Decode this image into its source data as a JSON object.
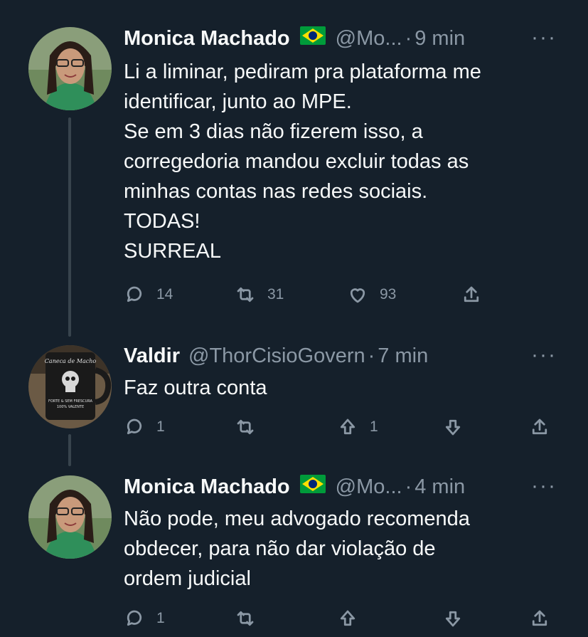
{
  "tweets": [
    {
      "name": "Monica Machado",
      "handle": "@Mo...",
      "time": "9 min",
      "text": "Li a liminar, pediram pra  plataforma me\nidentificar, junto ao MPE.\nSe em 3 dias não fizerem isso, a\ncorregedoria mandou excluir todas as\nminhas contas nas redes sociais.\nTODAS!\nSURREAL",
      "replies": "14",
      "retweets": "31",
      "likes": "93"
    },
    {
      "name": "Valdir",
      "handle": "@ThorCisioGovern",
      "time": "7 min",
      "text": "Faz outra conta",
      "replies": "1",
      "upvotes": "1",
      "avatar_mug_text": "Caneca de Macho",
      "avatar_mug_text2": "FORTE & SEM FRESCURA",
      "avatar_mug_text3": "100% VALENTE"
    },
    {
      "name": "Monica Machado",
      "handle": "@Mo...",
      "time": "4 min",
      "text": "Não pode, meu advogado recomenda\nobdecer, para não dar violação de\nordem judicial",
      "replies": "1"
    }
  ],
  "separator": "·",
  "more_glyph": "···",
  "colors": {
    "background": "#15202b",
    "text": "#f7f9f9",
    "muted": "#8b98a5",
    "thread": "#38444d"
  }
}
